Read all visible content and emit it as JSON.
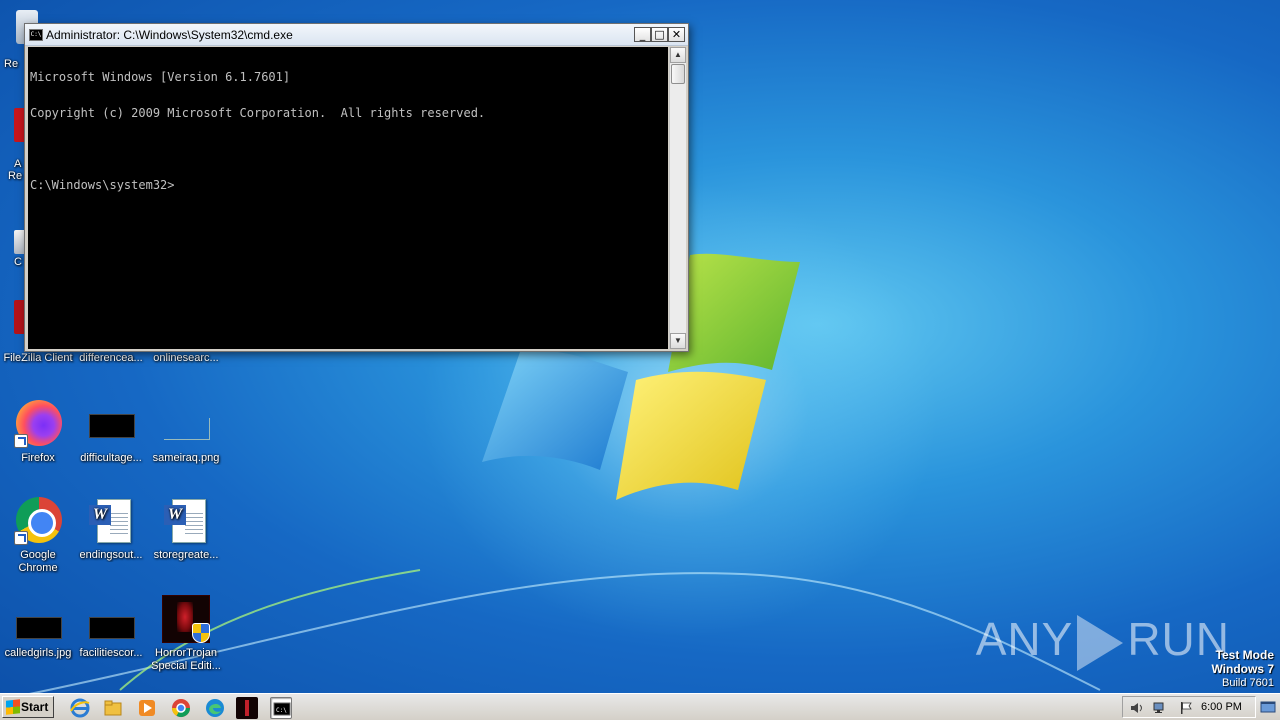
{
  "desktop": {
    "icons": [
      {
        "label": "FileZilla Client"
      },
      {
        "label": "differencea..."
      },
      {
        "label": "onlinesearc..."
      },
      {
        "label": "Firefox"
      },
      {
        "label": "difficultage..."
      },
      {
        "label": "sameiraq.png"
      },
      {
        "label": "Google Chrome"
      },
      {
        "label": "endingsout..."
      },
      {
        "label": "storegreate..."
      },
      {
        "label": "calledgirls.jpg"
      },
      {
        "label": "facilitiescor..."
      },
      {
        "label": "HorrorTrojan Special Editi..."
      }
    ],
    "partial_labels": [
      "Re",
      "A",
      "Re",
      "C"
    ]
  },
  "window": {
    "title": "Administrator: C:\\Windows\\System32\\cmd.exe",
    "icon_text": "C:\\",
    "buttons": {
      "minimize": "_",
      "maximize": "□",
      "close": "✕"
    },
    "console_lines": [
      "Microsoft Windows [Version 6.1.7601]",
      "Copyright (c) 2009 Microsoft Corporation.  All rights reserved.",
      "",
      "C:\\Windows\\system32>"
    ]
  },
  "watermark": {
    "left": "ANY",
    "right": "RUN"
  },
  "system_info": {
    "line1": "Test Mode",
    "line2": "Windows 7",
    "line3": "Build 7601"
  },
  "taskbar": {
    "start_label": "Start",
    "pinned": [
      "internet-explorer-icon",
      "explorer-folder-icon",
      "media-player-icon",
      "chrome-icon",
      "edge-icon",
      "horror-trojan-icon",
      "cmd-icon"
    ],
    "clock": "6:00 PM"
  },
  "colors": {
    "desktop_blue": "#1668c4",
    "console_bg": "#000000",
    "console_text": "#c0c0c0"
  }
}
